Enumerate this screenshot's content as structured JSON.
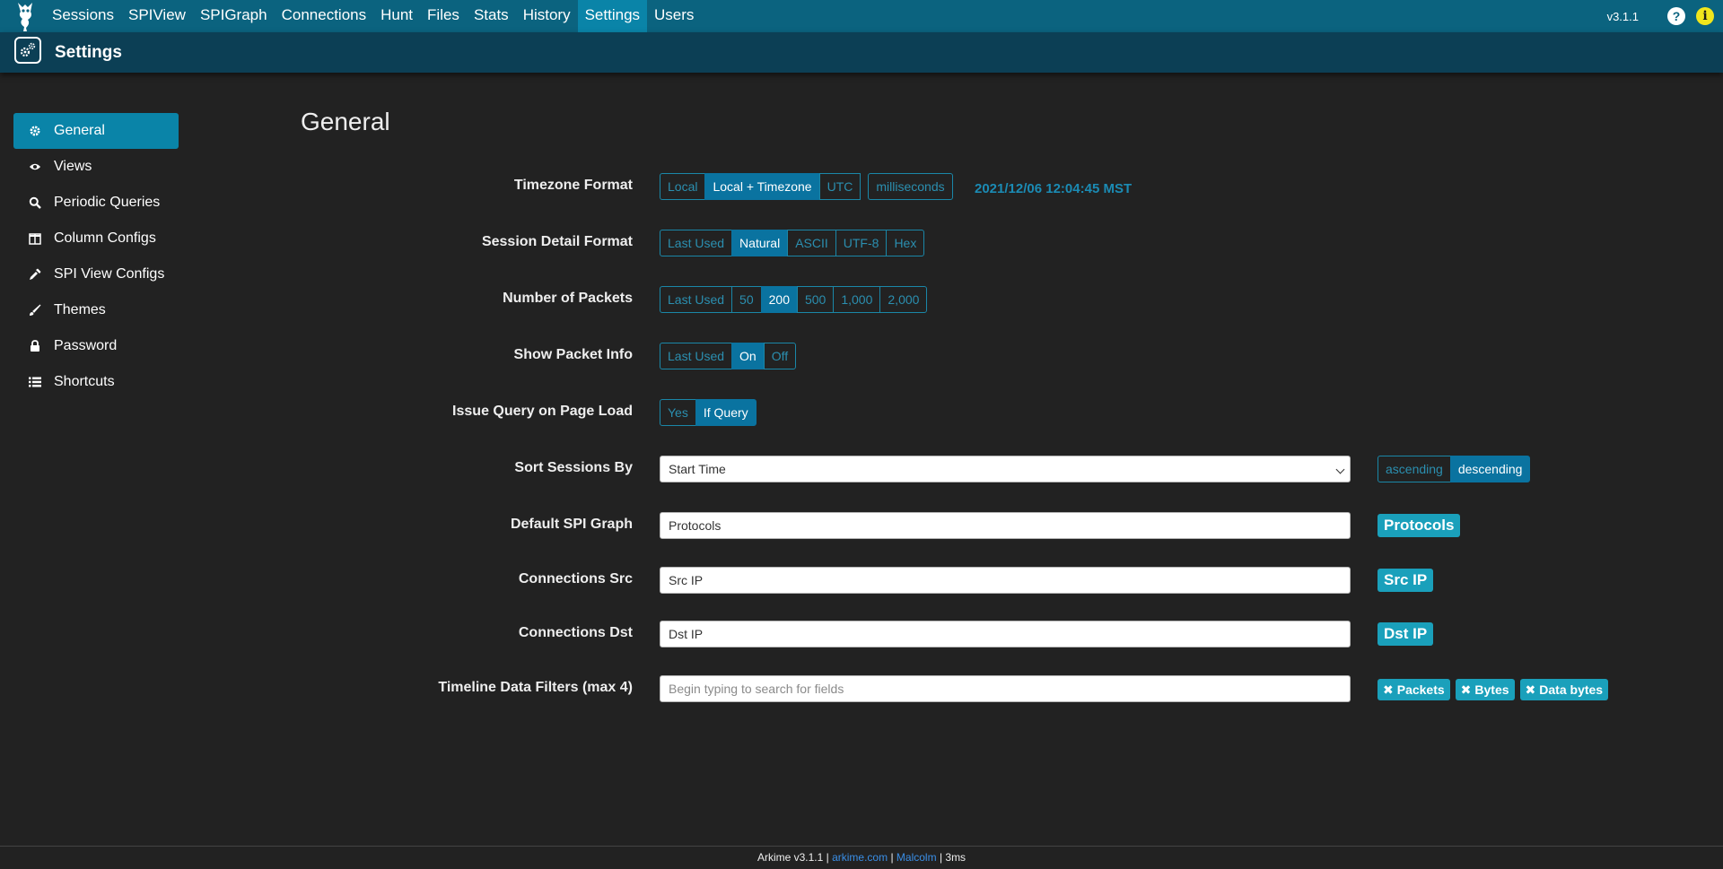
{
  "nav": {
    "items": [
      "Sessions",
      "SPIView",
      "SPIGraph",
      "Connections",
      "Hunt",
      "Files",
      "Stats",
      "History",
      "Settings",
      "Users"
    ],
    "active": "Settings",
    "version": "v3.1.1",
    "help_glyph": "?",
    "info_glyph": "i"
  },
  "header": {
    "title": "Settings"
  },
  "sidebar": {
    "items": [
      {
        "label": "General",
        "icon": "gear-icon",
        "active": true
      },
      {
        "label": "Views",
        "icon": "eye-icon"
      },
      {
        "label": "Periodic Queries",
        "icon": "search-icon"
      },
      {
        "label": "Column Configs",
        "icon": "columns-icon"
      },
      {
        "label": "SPI View Configs",
        "icon": "eyedropper-icon"
      },
      {
        "label": "Themes",
        "icon": "paintbrush-icon"
      },
      {
        "label": "Password",
        "icon": "lock-icon"
      },
      {
        "label": "Shortcuts",
        "icon": "list-icon"
      }
    ]
  },
  "main": {
    "title": "General",
    "timezone": {
      "label": "Timezone Format",
      "options": [
        "Local",
        "Local + Timezone",
        "UTC"
      ],
      "selected": "Local + Timezone",
      "extra": "milliseconds",
      "current_time": "2021/12/06 12:04:45 MST"
    },
    "session_detail": {
      "label": "Session Detail Format",
      "options": [
        "Last Used",
        "Natural",
        "ASCII",
        "UTF-8",
        "Hex"
      ],
      "selected": "Natural"
    },
    "packets": {
      "label": "Number of Packets",
      "options": [
        "Last Used",
        "50",
        "200",
        "500",
        "1,000",
        "2,000"
      ],
      "selected": "200"
    },
    "packet_info": {
      "label": "Show Packet Info",
      "options": [
        "Last Used",
        "On",
        "Off"
      ],
      "selected": "On"
    },
    "issue_query": {
      "label": "Issue Query on Page Load",
      "options": [
        "Yes",
        "If Query"
      ],
      "selected": "If Query"
    },
    "sort": {
      "label": "Sort Sessions By",
      "value": "Start Time",
      "order_options": [
        "ascending",
        "descending"
      ],
      "order_selected": "descending"
    },
    "spi_graph": {
      "label": "Default SPI Graph",
      "value": "Protocols",
      "badge": "Protocols"
    },
    "conn_src": {
      "label": "Connections Src",
      "value": "Src IP",
      "badge": "Src IP"
    },
    "conn_dst": {
      "label": "Connections Dst",
      "value": "Dst IP",
      "badge": "Dst IP"
    },
    "timeline": {
      "label": "Timeline Data Filters (max 4)",
      "placeholder": "Begin typing to search for fields",
      "chips": [
        "Packets",
        "Bytes",
        "Data bytes"
      ],
      "chip_glyph": "✖"
    }
  },
  "footer": {
    "prefix": "Arkime v3.1.1 |",
    "link1": "arkime.com",
    "sep": "|",
    "link2": "Malcolm",
    "suffix": "| 3ms"
  },
  "colors": {
    "nav": "#0b637f",
    "accent": "#0a84a8",
    "badge": "#1aa0bb",
    "background": "#222222"
  }
}
